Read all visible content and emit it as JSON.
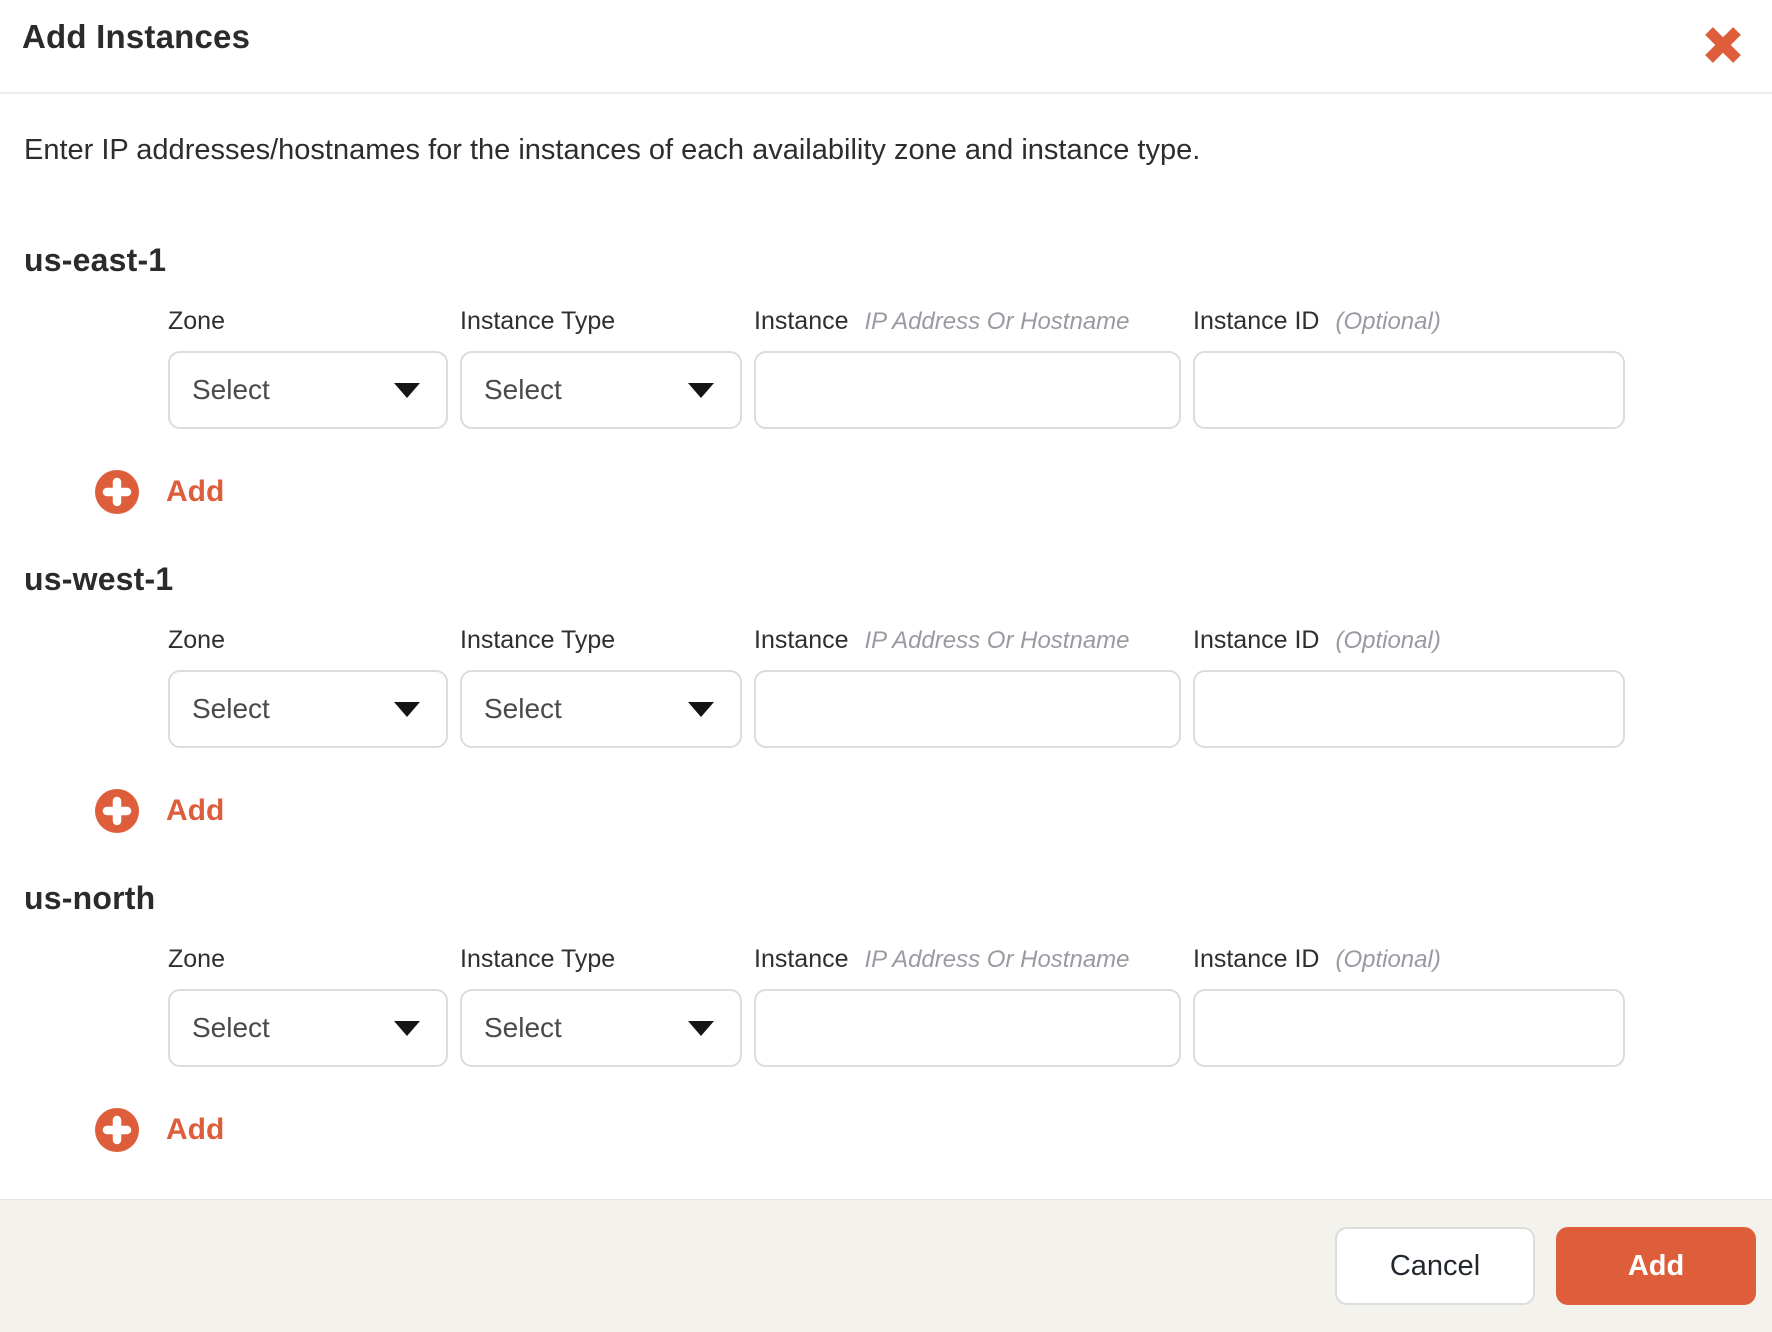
{
  "modal": {
    "title": "Add Instances",
    "description": "Enter IP addresses/hostnames for the instances of each availability zone and instance type."
  },
  "form": {
    "labels": {
      "zone": "Zone",
      "instance_type": "Instance Type",
      "instance": "Instance",
      "instance_hint": "IP Address Or Hostname",
      "instance_id": "Instance ID",
      "instance_id_hint": "(Optional)"
    },
    "select_placeholder": "Select",
    "add_row_label": "Add",
    "sections": [
      {
        "title": "us-east-1"
      },
      {
        "title": "us-west-1"
      },
      {
        "title": "us-north"
      }
    ],
    "inputs": {
      "instance_value": "",
      "instance_id_value": ""
    }
  },
  "footer": {
    "cancel_label": "Cancel",
    "add_label": "Add"
  },
  "colors": {
    "accent_orange": "#de5e3b",
    "footer_bg": "#f3f2ec"
  }
}
